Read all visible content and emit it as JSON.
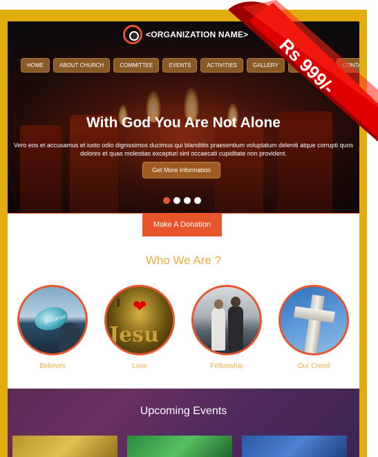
{
  "logo": {
    "text": "<ORGANIZATION NAME>"
  },
  "nav": {
    "items": [
      "HOME",
      "ABOUT CHURCH",
      "COMMITTEE",
      "EVENTS",
      "ACTIVITIES",
      "GALLERY",
      "DOWNLOAD",
      "CONTACT"
    ]
  },
  "hero": {
    "title": "With God You Are Not Alone",
    "text": "Vero eos et accusamus et iusto odio dignissimos ducimus qui blanditiis praesentium voluptatum deleniti atque corrupti quos dolores et quas molestias excepturi sint occaecati cupiditate non provident.",
    "button_label": "Get More Information",
    "slide_count": 4,
    "active_slide": 1
  },
  "donation": {
    "button_label": "Make A Donation"
  },
  "who_we_are": {
    "title": "Who We Are ?",
    "items": [
      {
        "label": "Believes",
        "icon": "believe-stone-image"
      },
      {
        "label": "Love",
        "icon": "jesus-heart-image"
      },
      {
        "label": "Fellowship",
        "icon": "couple-walking-image"
      },
      {
        "label": "Our Creed",
        "icon": "cross-sky-image"
      }
    ]
  },
  "events": {
    "title": "Upcoming Events"
  },
  "badge": {
    "price": "Rs 999/-"
  },
  "colors": {
    "accent": "#e8552d",
    "gold": "#f0ad3c",
    "frame": "#e2ad10",
    "ribbon": "#e00000"
  }
}
